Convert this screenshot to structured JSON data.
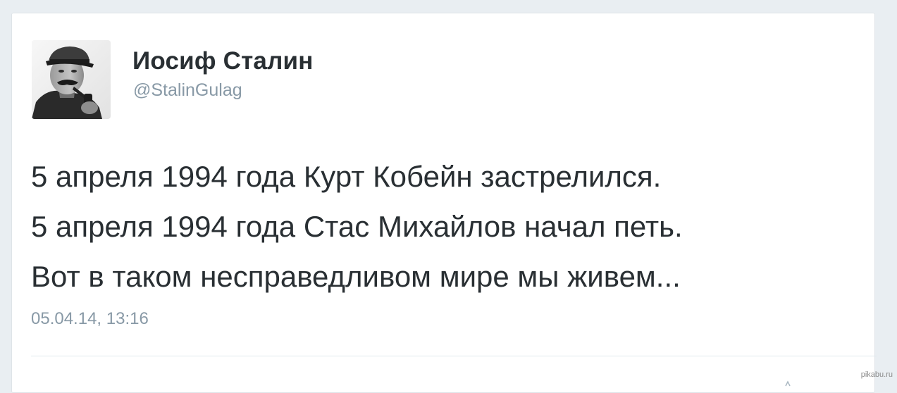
{
  "tweet": {
    "display_name": "Иосиф Сталин",
    "username": "@StalinGulag",
    "avatar_icon": "portrait-photo",
    "text_lines": [
      "5 апреля 1994 года Курт Кобейн застрелился.",
      "5 апреля 1994 года Стас Михайлов начал петь.",
      "Вот в таком несправедливом мире мы живем..."
    ],
    "timestamp": "05.04.14, 13:16"
  },
  "watermark": "pikabu.ru",
  "colors": {
    "background": "#e9eef2",
    "card": "#ffffff",
    "text": "#292f33",
    "secondary": "#8899a6"
  }
}
